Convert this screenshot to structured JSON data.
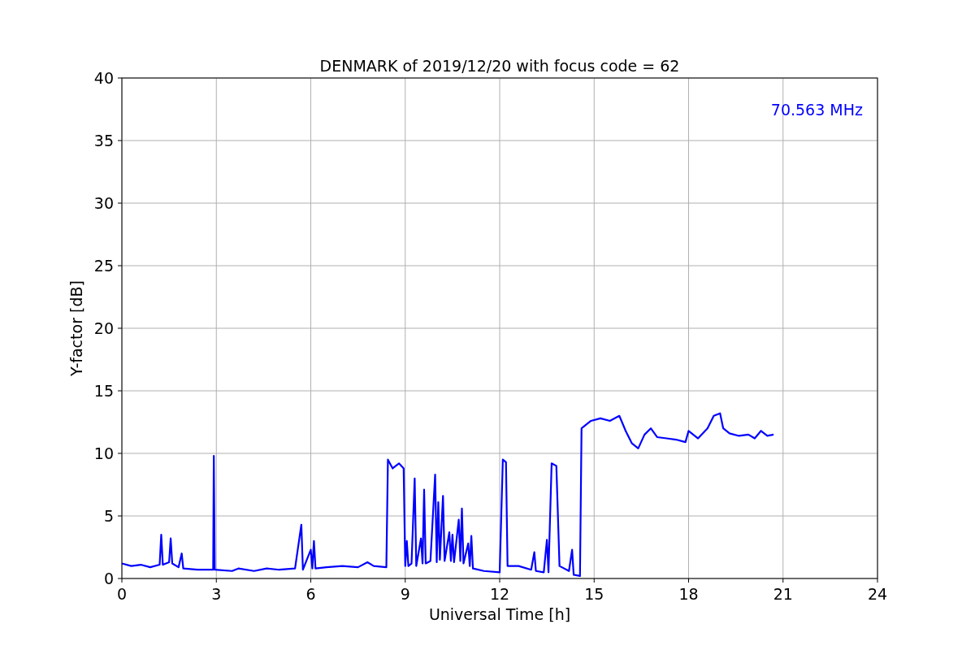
{
  "figure": {
    "chart_data": {
      "type": "line",
      "title": "DENMARK of 2019/12/20 with focus code = 62",
      "xlabel": "Universal Time [h]",
      "ylabel": "Y-factor [dB]",
      "x": [
        0,
        0.3,
        0.6,
        0.9,
        1.2,
        1.25,
        1.3,
        1.5,
        1.55,
        1.6,
        1.8,
        1.9,
        1.95,
        2.4,
        2.9,
        2.92,
        2.95,
        3.5,
        3.7,
        4.2,
        4.6,
        5.0,
        5.5,
        5.7,
        5.75,
        6.0,
        6.05,
        6.1,
        6.15,
        6.5,
        7.0,
        7.5,
        7.8,
        8.0,
        8.4,
        8.45,
        8.6,
        8.8,
        8.95,
        9.0,
        9.05,
        9.1,
        9.2,
        9.3,
        9.35,
        9.5,
        9.55,
        9.6,
        9.65,
        9.8,
        9.95,
        10.0,
        10.05,
        10.1,
        10.2,
        10.25,
        10.4,
        10.45,
        10.5,
        10.55,
        10.7,
        10.75,
        10.8,
        10.85,
        11.0,
        11.05,
        11.1,
        11.15,
        11.5,
        12.0,
        12.1,
        12.2,
        12.25,
        12.6,
        13.0,
        13.1,
        13.15,
        13.4,
        13.5,
        13.55,
        13.65,
        13.8,
        13.9,
        14.2,
        14.3,
        14.35,
        14.55,
        14.6,
        14.9,
        15.2,
        15.5,
        15.8,
        16.0,
        16.2,
        16.4,
        16.6,
        16.8,
        17.0,
        17.3,
        17.6,
        17.9,
        18.0,
        18.3,
        18.6,
        18.8,
        19.0,
        19.1,
        19.3,
        19.6,
        19.9,
        20.1,
        20.3,
        20.5,
        20.7
      ],
      "series": [
        {
          "name": "70.563 MHz",
          "color": "#0000ff",
          "values": [
            1.2,
            1.0,
            1.1,
            0.9,
            1.1,
            3.5,
            1.1,
            1.3,
            3.2,
            1.2,
            0.9,
            2.0,
            0.8,
            0.7,
            0.7,
            9.8,
            0.7,
            0.6,
            0.8,
            0.6,
            0.8,
            0.7,
            0.8,
            4.3,
            0.7,
            2.3,
            0.8,
            3.0,
            0.8,
            0.9,
            1.0,
            0.9,
            1.3,
            1.0,
            0.9,
            9.5,
            8.8,
            9.2,
            8.8,
            1.0,
            3.0,
            1.0,
            1.2,
            8.0,
            1.0,
            3.2,
            1.2,
            7.1,
            1.2,
            1.4,
            8.3,
            1.3,
            6.1,
            1.5,
            6.6,
            1.4,
            3.7,
            1.4,
            3.5,
            1.3,
            4.7,
            1.4,
            5.6,
            1.2,
            2.8,
            1.0,
            3.4,
            0.8,
            0.6,
            0.5,
            9.5,
            9.3,
            1.0,
            1.0,
            0.7,
            2.1,
            0.6,
            0.5,
            3.1,
            0.5,
            9.2,
            9.0,
            1.0,
            0.6,
            2.3,
            0.3,
            0.2,
            12.0,
            12.6,
            12.8,
            12.6,
            13.0,
            11.8,
            10.8,
            10.4,
            11.5,
            12.0,
            11.3,
            11.2,
            11.1,
            10.9,
            11.8,
            11.2,
            12.0,
            13.0,
            13.2,
            12.0,
            11.6,
            11.4,
            11.5,
            11.2,
            11.8,
            11.4,
            11.5
          ]
        }
      ],
      "xlim": [
        0,
        24
      ],
      "ylim": [
        0,
        40
      ],
      "xticks": [
        0,
        3,
        6,
        9,
        12,
        15,
        18,
        21,
        24
      ],
      "yticks": [
        0,
        5,
        10,
        15,
        20,
        25,
        30,
        35,
        40
      ],
      "grid": true
    }
  }
}
